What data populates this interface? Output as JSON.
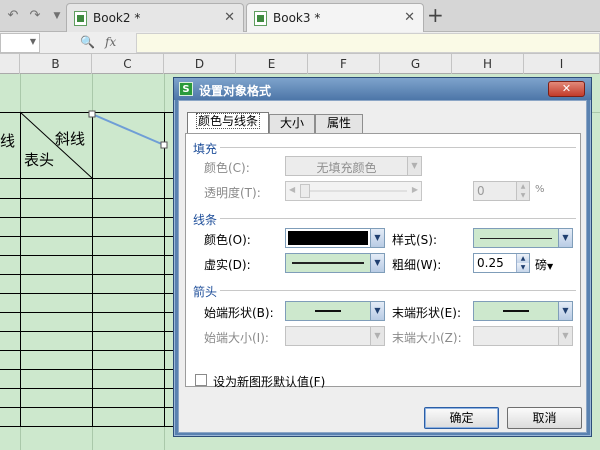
{
  "tabbar": {
    "tabs": [
      {
        "label": "Book2 *",
        "close": "✕"
      },
      {
        "label": "Book3 *",
        "close": "✕"
      }
    ],
    "new_tab": "+"
  },
  "formula_bar": {
    "fx_label": "fx",
    "cell_value": ""
  },
  "sheet": {
    "columns": [
      "B",
      "C",
      "D",
      "E",
      "F",
      "G",
      "H",
      "I"
    ],
    "cell_texts": {
      "left_partial": "线",
      "diag_top": "斜线",
      "diag_bottom": "表头"
    },
    "grid_color": "#cde8cd"
  },
  "dialog": {
    "title": "设置对象格式",
    "close_label": "✕",
    "tabs": [
      {
        "label": "颜色与线条"
      },
      {
        "label": "大小"
      },
      {
        "label": "属性"
      }
    ],
    "fill": {
      "section": "填充",
      "color_label": "颜色(C):",
      "color_value": "无填充颜色",
      "transparency_label": "透明度(T):",
      "transparency_value": "0",
      "transparency_unit": "%"
    },
    "line": {
      "section": "线条",
      "color_label": "颜色(O):",
      "color_value": "#000000",
      "dash_label": "虚实(D):",
      "style_label": "样式(S):",
      "weight_label": "粗细(W):",
      "weight_value": "0.25",
      "weight_unit": "磅"
    },
    "arrows": {
      "section": "箭头",
      "begin_style_label": "始端形状(B):",
      "end_style_label": "末端形状(E):",
      "begin_size_label": "始端大小(I):",
      "end_size_label": "末端大小(Z):"
    },
    "default_checkbox_label": "设为新图形默认值(F)",
    "ok_label": "确定",
    "cancel_label": "取消"
  }
}
